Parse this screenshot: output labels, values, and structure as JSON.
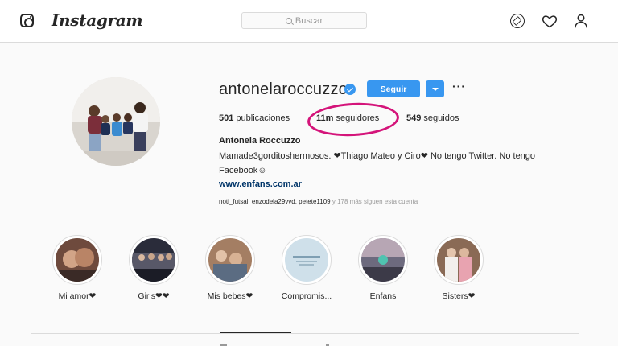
{
  "nav": {
    "wordmark": "Instagram",
    "search_placeholder": "Buscar"
  },
  "profile": {
    "username": "antonelaroccuzzo",
    "verified": true,
    "follow_label": "Seguir",
    "posts_count": "501",
    "posts_label": "publicaciones",
    "followers_count": "11m",
    "followers_label": "seguidores",
    "following_count": "549",
    "following_label": "seguidos",
    "full_name": "Antonela Roccuzzo",
    "bio_line1": "Mamade3gorditoshermosos. ❤Thiago Mateo y Ciro❤ No tengo Twitter. No tengo",
    "bio_line2": "Facebook☺",
    "website": "www.enfans.com.ar",
    "followed_by_names": "noti_futsal, enzodela29vvd, petete1109",
    "followed_by_rest": "y 178 más siguen esta cuenta"
  },
  "highlights": [
    {
      "label": "Mi amor❤"
    },
    {
      "label": "Girls❤❤"
    },
    {
      "label": "Mis bebes❤"
    },
    {
      "label": "Compromis..."
    },
    {
      "label": "Enfans"
    },
    {
      "label": "Sisters❤"
    }
  ],
  "colors": {
    "accent": "#3897f0",
    "annotation": "#d4147a",
    "link": "#003569"
  },
  "icons": [
    "instagram-logo-icon",
    "search-icon",
    "compass-icon",
    "heart-icon",
    "user-icon",
    "verified-badge-icon",
    "chevron-down-icon",
    "more-options-icon"
  ]
}
